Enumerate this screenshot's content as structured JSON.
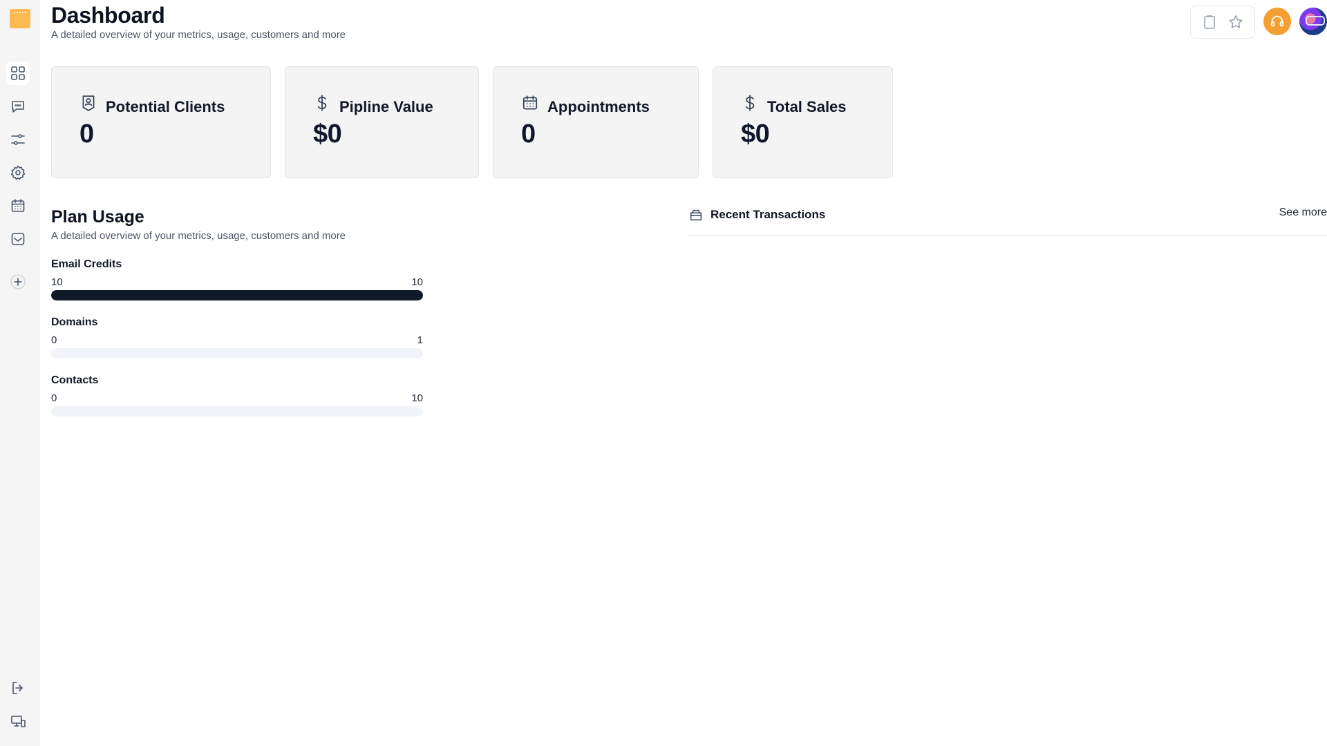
{
  "header": {
    "title": "Dashboard",
    "subtitle": "A detailed overview of your metrics, usage, customers and more"
  },
  "sidebar": {
    "items": [
      {
        "icon": "dashboard-grid-icon",
        "active": true
      },
      {
        "icon": "chat-icon"
      },
      {
        "icon": "sliders-icon"
      },
      {
        "icon": "settings-gear-icon"
      },
      {
        "icon": "calendar-icon"
      },
      {
        "icon": "inbox-icon"
      },
      {
        "icon": "plus-circle-icon"
      }
    ],
    "bottom_items": [
      {
        "icon": "logout-icon"
      },
      {
        "icon": "devices-icon"
      }
    ]
  },
  "top_actions": {
    "icons": [
      "clipboard-icon",
      "star-icon",
      "headset-icon",
      "avatar"
    ],
    "support_color": "#f59e32"
  },
  "stats": [
    {
      "icon": "contact-badge-icon",
      "label": "Potential Clients",
      "value": "0"
    },
    {
      "icon": "dollar-icon",
      "label": "Pipline Value",
      "value": "$0"
    },
    {
      "icon": "calendar-icon",
      "label": "Appointments",
      "value": "0"
    },
    {
      "icon": "dollar-icon",
      "label": "Total Sales",
      "value": "$0"
    }
  ],
  "plan_usage": {
    "title": "Plan Usage",
    "subtitle": "A detailed overview of your metrics, usage, customers and more",
    "items": [
      {
        "label": "Email Credits",
        "used": "10",
        "limit": "10",
        "fraction": 1.0
      },
      {
        "label": "Domains",
        "used": "0",
        "limit": "1",
        "fraction": 0
      },
      {
        "label": "Contacts",
        "used": "0",
        "limit": "10",
        "fraction": 0
      }
    ]
  },
  "transactions": {
    "title": "Recent Transactions",
    "see_more": "See more"
  }
}
